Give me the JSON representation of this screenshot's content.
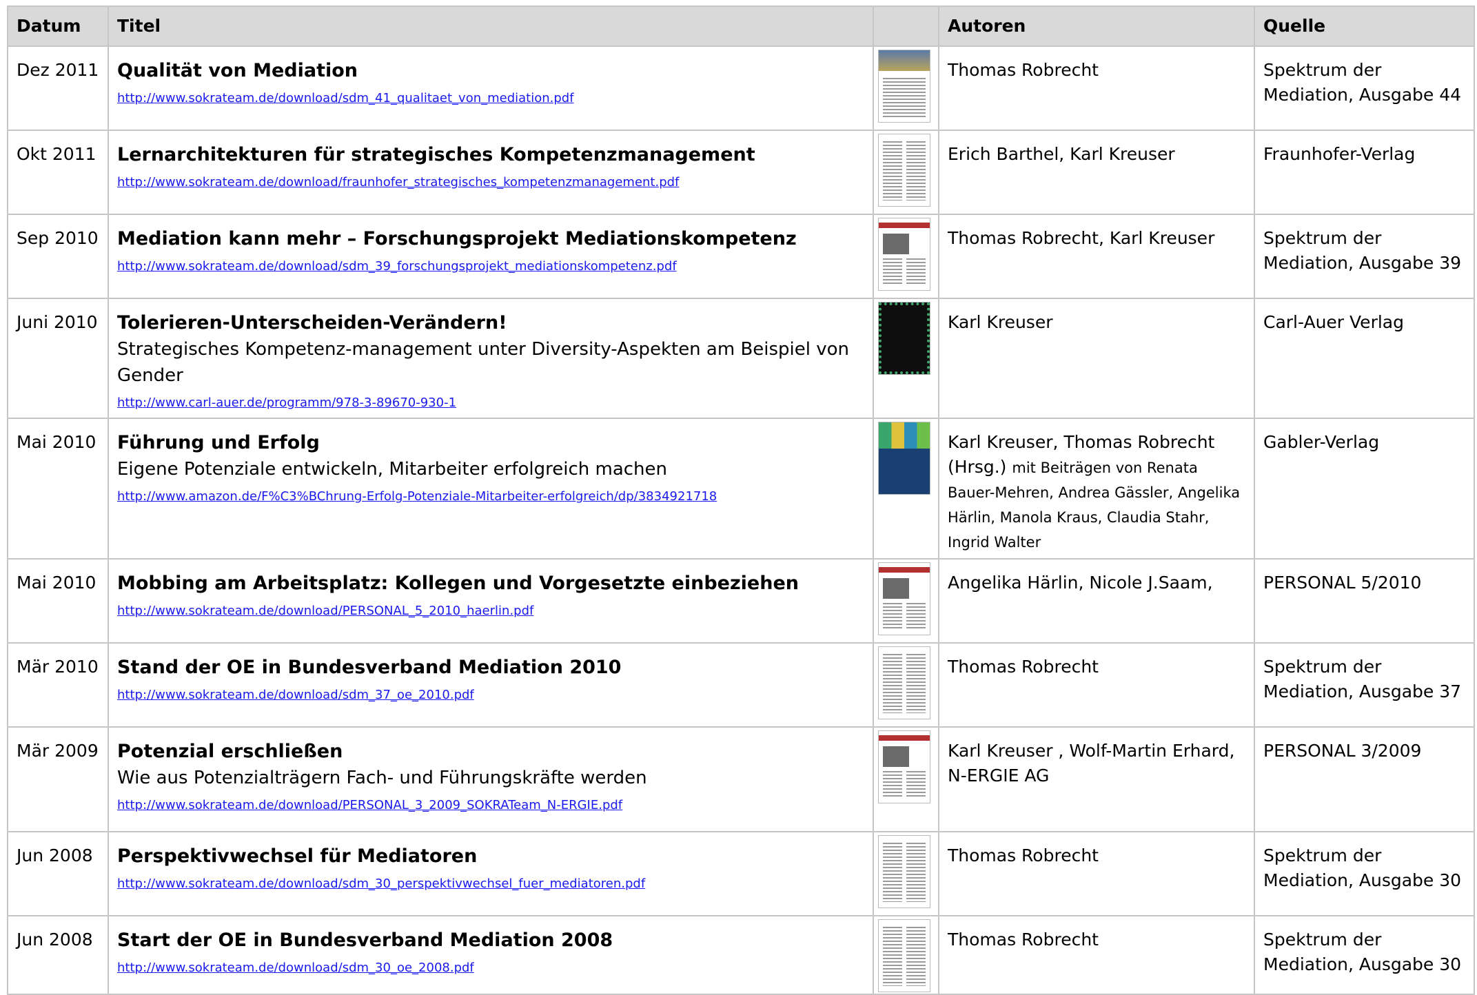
{
  "header": {
    "datum": "Datum",
    "titel": "Titel",
    "autoren": "Autoren",
    "quelle": "Quelle"
  },
  "rows": [
    {
      "datum": "Dez 2011",
      "title": "Qualität von Mediation",
      "subtitle": "",
      "url": "http://www.sokrateam.de/download/sdm_41_qualitaet_von_mediation.pdf",
      "authors": "Thomas Robrecht",
      "authors_extra": "",
      "source": "Spektrum der Mediation, Ausgabe 44",
      "thumb_icon": "article-cover-landscape-icon"
    },
    {
      "datum": "Okt 2011",
      "title": "Lernarchitekturen für strategisches Kompetenzmanagement",
      "subtitle": "",
      "url": "http://www.sokrateam.de/download/fraunhofer_strategisches_kompetenzmanagement.pdf",
      "authors": "Erich Barthel, Karl Kreuser",
      "authors_extra": "",
      "source": "Fraunhofer-Verlag",
      "thumb_icon": "article-page-icon"
    },
    {
      "datum": "Sep 2010",
      "title": "Mediation kann mehr – Forschungsprojekt Mediationskompetenz",
      "subtitle": "",
      "url": "http://www.sokrateam.de/download/sdm_39_forschungsprojekt_mediationskompetenz.pdf",
      "authors": "Thomas Robrecht, Karl Kreuser",
      "authors_extra": "",
      "source": "Spektrum der Mediation, Ausgabe 39",
      "thumb_icon": "article-page-photo-icon"
    },
    {
      "datum": "Juni 2010",
      "title": "Tolerieren-Unterscheiden-Verändern!",
      "subtitle": "Strategisches Kompetenz-management unter Diversity-Aspekten am Beispiel von Gender",
      "url": "http://www.carl-auer.de/programm/978-3-89670-930-1",
      "authors": "Karl Kreuser",
      "authors_extra": "",
      "source": "Carl-Auer Verlag",
      "thumb_icon": "book-cover-dark-icon"
    },
    {
      "datum": "Mai 2010",
      "title": "Führung und Erfolg",
      "subtitle": "Eigene Potenziale entwickeln, Mitarbeiter erfolgreich machen",
      "url": "http://www.amazon.de/F%C3%BChrung-Erfolg-Potenziale-Mitarbeiter-erfolgreich/dp/3834921718",
      "authors": "Karl Kreuser, Thomas Robrecht (Hrsg.)",
      "authors_extra": "mit Beiträgen von Renata Bauer-Mehren, Andrea Gässler, Angelika Härlin, Manola Kraus, Claudia Stahr, Ingrid Walter",
      "source": "Gabler-Verlag",
      "thumb_icon": "book-cover-blue-icon"
    },
    {
      "datum": "Mai 2010",
      "title": "Mobbing am Arbeitsplatz: Kollegen und Vorgesetzte einbeziehen",
      "subtitle": "",
      "url": "http://www.sokrateam.de/download/PERSONAL_5_2010_haerlin.pdf",
      "authors": "Angelika Härlin, Nicole J.Saam,",
      "authors_extra": "",
      "source": "PERSONAL 5/2010",
      "thumb_icon": "magazine-page-photo-icon"
    },
    {
      "datum": "Mär 2010",
      "title": "Stand der OE in Bundesverband Mediation 2010",
      "subtitle": "",
      "url": "http://www.sokrateam.de/download/sdm_37_oe_2010.pdf",
      "authors": "Thomas Robrecht",
      "authors_extra": "",
      "source": "Spektrum der Mediation, Ausgabe 37",
      "thumb_icon": "article-page-icon"
    },
    {
      "datum": "Mär 2009",
      "title": "Potenzial erschließen",
      "subtitle": "Wie aus Potenzialträgern Fach- und Führungskräfte werden",
      "url": "http://www.sokrateam.de/download/PERSONAL_3_2009_SOKRATeam_N-ERGIE.pdf",
      "authors": "Karl Kreuser , Wolf-Martin Erhard, N-ERGIE AG",
      "authors_extra": "",
      "source": "PERSONAL 3/2009",
      "thumb_icon": "magazine-page-photo-icon"
    },
    {
      "datum": "Jun 2008",
      "title": "Perspektivwechsel für Mediatoren",
      "subtitle": "",
      "url": "http://www.sokrateam.de/download/sdm_30_perspektivwechsel_fuer_mediatoren.pdf",
      "authors": "Thomas Robrecht",
      "authors_extra": "",
      "source": "Spektrum der Mediation, Ausgabe 30",
      "thumb_icon": "article-page-icon"
    },
    {
      "datum": "Jun 2008",
      "title": "Start der OE in Bundesverband Mediation 2008",
      "subtitle": "",
      "url": "http://www.sokrateam.de/download/sdm_30_oe_2008.pdf",
      "authors": "Thomas Robrecht",
      "authors_extra": "",
      "source": "Spektrum der Mediation, Ausgabe 30",
      "thumb_icon": "article-page-icon"
    }
  ]
}
